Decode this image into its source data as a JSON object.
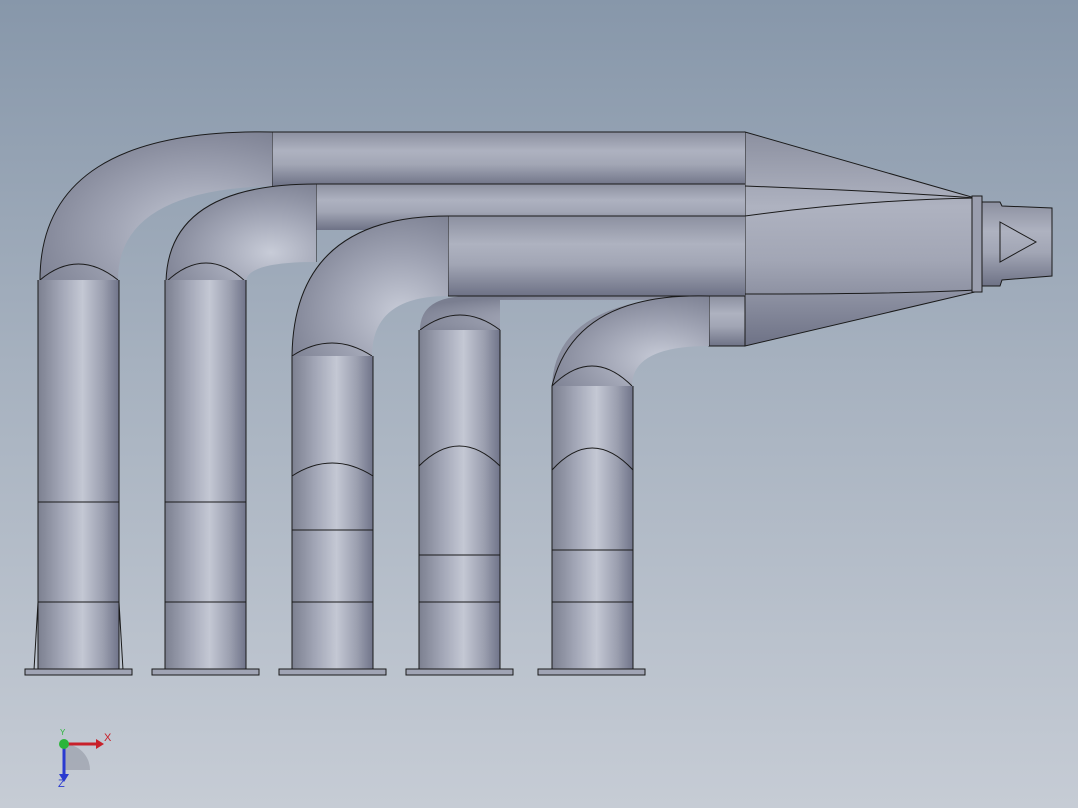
{
  "view": {
    "model": "exhaust-header-assembly",
    "background_top": "#8797aa",
    "background_bottom": "#c6ccd5",
    "pipe_color": "#9ea2b2",
    "edge_color": "#1a1a1a"
  },
  "triad": {
    "x_label": "X",
    "y_label": "Y",
    "z_label": "Z",
    "x_color": "#c8202a",
    "y_color": "#2ab53a",
    "z_color": "#2a3ad0"
  }
}
